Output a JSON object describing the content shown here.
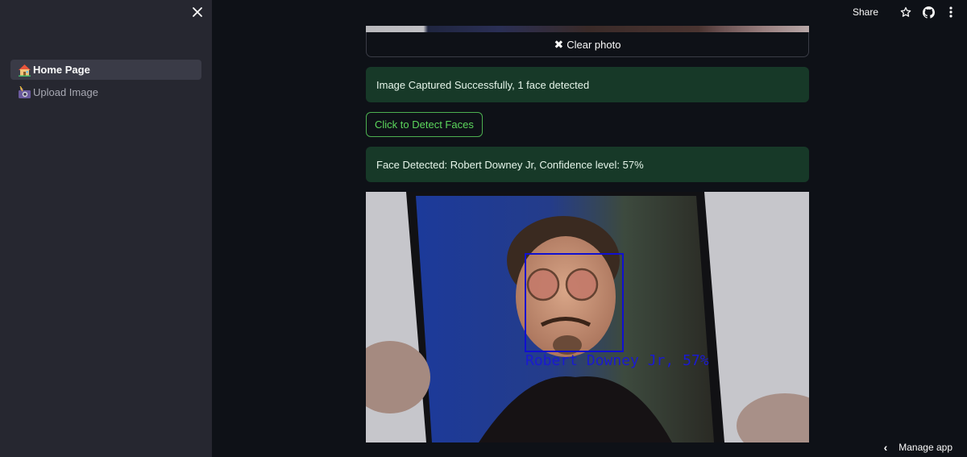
{
  "sidebar": {
    "close_icon": "close-icon",
    "items": [
      {
        "label": "Home Page",
        "icon": "house-emoji-icon",
        "active": true
      },
      {
        "label": "Upload Image",
        "icon": "camera-flash-emoji-icon",
        "active": false
      }
    ]
  },
  "header": {
    "share_label": "Share",
    "icons": [
      "star-icon",
      "github-icon",
      "kebab-menu-icon"
    ]
  },
  "main": {
    "clear_photo_label": "Clear photo",
    "capture_status": "Image Captured Successfully, 1 face detected",
    "detect_button_label": "Click to Detect Faces",
    "detection_result": "Face Detected: Robert Downey Jr, Confidence level: 57%",
    "photo": {
      "description": "Phone screen showing a photo of a man with tinted round glasses, with a blue face-detection box",
      "overlay_label": "Robert Downey Jr, 57%",
      "box_color": "#1010d0"
    }
  },
  "footer": {
    "manage_app_label": "Manage app"
  },
  "colors": {
    "background": "#0e1117",
    "sidebar": "#262730",
    "success_bg": "#173928",
    "accent_green": "#5cd65c"
  }
}
